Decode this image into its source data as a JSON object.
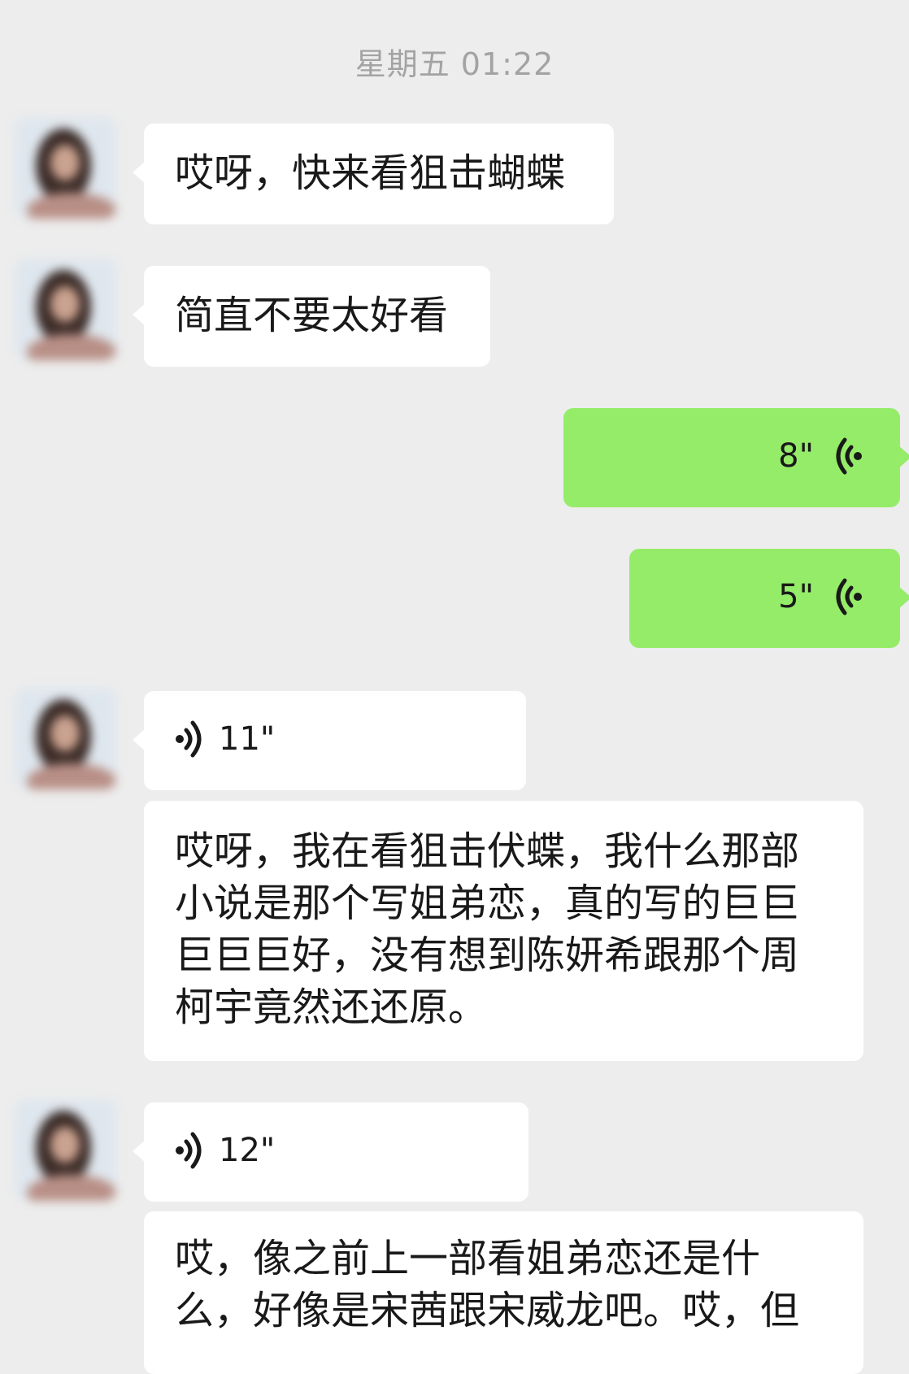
{
  "header": {
    "timestamp": "星期五 01:22"
  },
  "messages": [
    {
      "type": "text",
      "direction": "incoming",
      "text": "哎呀，快来看狙击蝴蝶"
    },
    {
      "type": "text",
      "direction": "incoming",
      "text": "简直不要太好看"
    },
    {
      "type": "voice",
      "direction": "outgoing",
      "duration": "8\"",
      "icon": "voice-wave-icon"
    },
    {
      "type": "voice",
      "direction": "outgoing",
      "duration": "5\"",
      "icon": "voice-wave-icon"
    },
    {
      "type": "voice",
      "direction": "incoming",
      "duration": "11\"",
      "icon": "voice-wave-icon"
    },
    {
      "type": "text",
      "direction": "incoming",
      "text": "哎呀，我在看狙击伏蝶，我什么那部\n小说是那个写姐弟恋，真的写的巨巨\n巨巨巨好，没有想到陈妍希跟那个周\n柯宇竟然还还原。"
    },
    {
      "type": "voice",
      "direction": "incoming",
      "duration": "12\"",
      "icon": "voice-wave-icon"
    },
    {
      "type": "text",
      "direction": "incoming",
      "text": "哎，像之前上一部看姐弟恋还是什\n么，好像是宋茜跟宋威龙吧。哎，但"
    }
  ],
  "colors": {
    "background": "#ededed",
    "incoming_bubble": "#ffffff",
    "outgoing_bubble": "#95ec69",
    "timestamp_text": "#a3a3a3"
  }
}
